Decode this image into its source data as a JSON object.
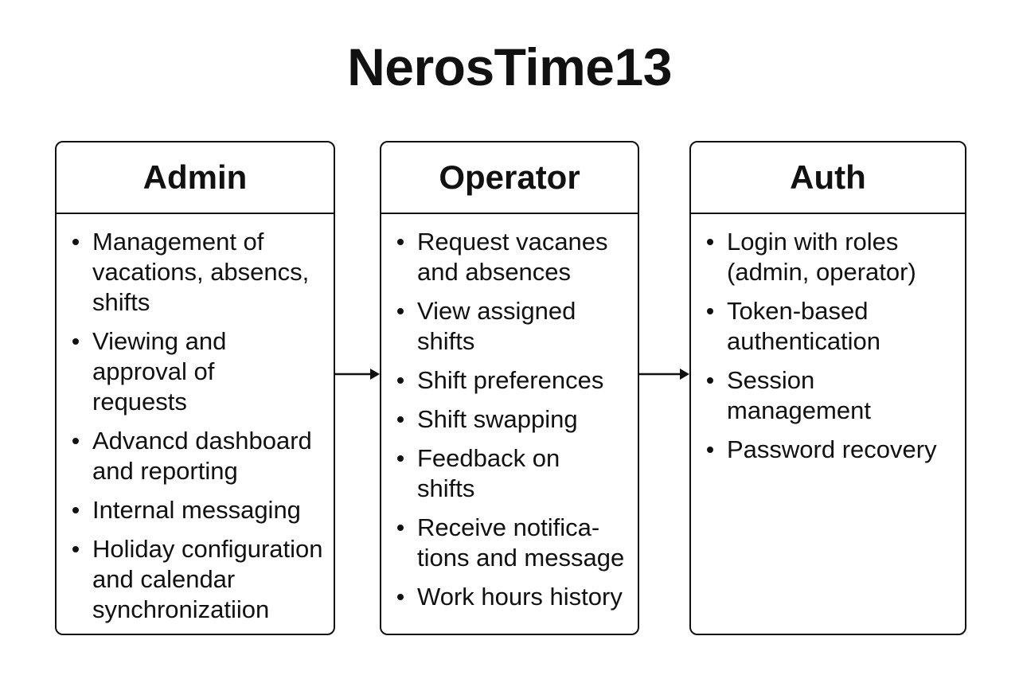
{
  "title": "NerosTime13",
  "boxes": [
    {
      "header": "Admin",
      "items": [
        "Management of\nvacations, absencs,\nshifts",
        "Viewing and\napproval of\nrequests",
        "Advancd dashboard\nand reporting",
        "Internal messaging",
        "Holiday configuration\nand calendar\nsynchronizatiion"
      ]
    },
    {
      "header": "Operator",
      "items": [
        "Request vacanes\nand absences",
        "View assigned\nshifts",
        "Shift preferences",
        "Shift swapping",
        "Feedback on\nshifts",
        "Receive notifica-\ntions and message",
        "Work hours history"
      ]
    },
    {
      "header": "Auth",
      "items": [
        "Login with roles\n(admin, operator)",
        "Token-based\nauthentication",
        "Session\nmanagement",
        "Password recovery"
      ]
    }
  ]
}
